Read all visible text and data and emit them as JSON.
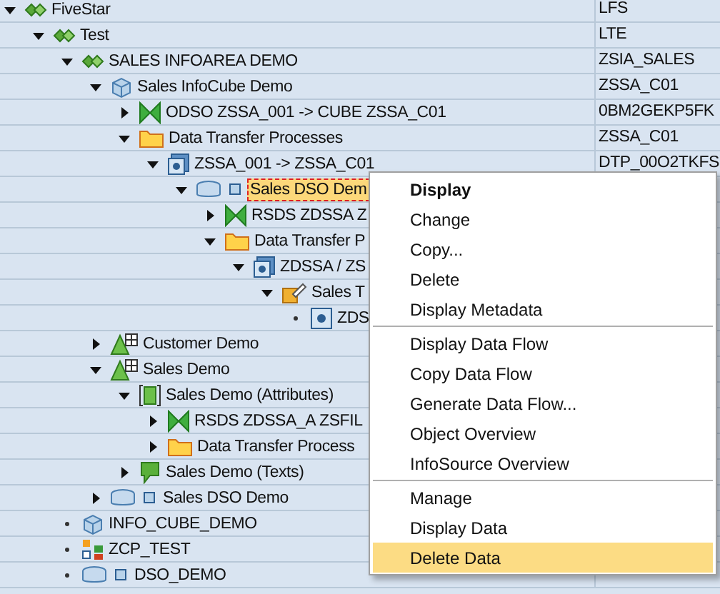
{
  "tree": [
    {
      "label": "FiveStar",
      "kind": "infoarea",
      "expanded": true,
      "selected": false,
      "technical_name": "LFS",
      "children": [
        {
          "label": "Test",
          "kind": "infoarea",
          "expanded": true,
          "selected": false,
          "technical_name": "LTE",
          "children": [
            {
              "label": "SALES INFOAREA DEMO",
              "kind": "infoarea",
              "expanded": true,
              "selected": false,
              "technical_name": "ZSIA_SALES",
              "children": [
                {
                  "label": "Sales InfoCube Demo",
                  "kind": "cube",
                  "expanded": true,
                  "selected": false,
                  "technical_name": "ZSSA_C01",
                  "children": [
                    {
                      "label": "ODSO ZSSA_001 -> CUBE ZSSA_C01",
                      "kind": "transformation",
                      "expanded": false,
                      "selected": false,
                      "technical_name": "0BM2GEKP5FK"
                    },
                    {
                      "label": "Data Transfer Processes",
                      "kind": "folder",
                      "expanded": true,
                      "selected": false,
                      "technical_name": "ZSSA_C01",
                      "children": [
                        {
                          "label": "ZSSA_001 -> ZSSA_C01",
                          "kind": "dtp",
                          "expanded": true,
                          "selected": false,
                          "technical_name": "DTP_00O2TKFS",
                          "children": [
                            {
                              "label": "Sales DSO Dem",
                              "kind": "dso",
                              "expanded": true,
                              "selected": true,
                              "children": [
                                {
                                  "label": "RSDS ZDSSA Z",
                                  "kind": "transformation",
                                  "expanded": false,
                                  "selected": false
                                },
                                {
                                  "label": "Data Transfer P",
                                  "kind": "folder",
                                  "expanded": true,
                                  "selected": false,
                                  "children": [
                                    {
                                      "label": "ZDSSA / ZS",
                                      "kind": "dtp",
                                      "expanded": true,
                                      "selected": false,
                                      "children": [
                                        {
                                          "label": "Sales T",
                                          "kind": "infosource",
                                          "expanded": true,
                                          "selected": false,
                                          "children": [
                                            {
                                              "label": "ZDS",
                                              "kind": "datasource",
                                              "selected": false
                                            }
                                          ]
                                        }
                                      ]
                                    }
                                  ]
                                }
                              ]
                            }
                          ]
                        }
                      ]
                    }
                  ]
                },
                {
                  "label": "Customer Demo",
                  "kind": "characteristic",
                  "expanded": false,
                  "selected": false
                },
                {
                  "label": "Sales Demo",
                  "kind": "characteristic",
                  "expanded": true,
                  "selected": false,
                  "children": [
                    {
                      "label": "Sales Demo (Attributes)",
                      "kind": "attributes",
                      "expanded": true,
                      "selected": false,
                      "children": [
                        {
                          "label": "RSDS ZDSSA_A ZSFIL",
                          "kind": "transformation",
                          "expanded": false,
                          "selected": false
                        },
                        {
                          "label": "Data Transfer Process",
                          "kind": "folder",
                          "expanded": false,
                          "selected": false
                        }
                      ]
                    },
                    {
                      "label": "Sales Demo (Texts)",
                      "kind": "texts",
                      "expanded": false,
                      "selected": false
                    }
                  ]
                },
                {
                  "label": "Sales DSO Demo",
                  "kind": "dso",
                  "expanded": false,
                  "selected": false
                }
              ]
            },
            {
              "label": "INFO_CUBE_DEMO",
              "kind": "cube",
              "selected": false
            },
            {
              "label": "ZCP_TEST",
              "kind": "squares",
              "selected": false
            },
            {
              "label": "DSO_DEMO",
              "kind": "dso",
              "selected": false
            }
          ]
        }
      ]
    }
  ],
  "context_menu": [
    {
      "label": "Display",
      "kind": "item",
      "bold": true,
      "selected": false
    },
    {
      "label": "Change",
      "kind": "item",
      "bold": false,
      "selected": false
    },
    {
      "label": "Copy...",
      "kind": "item",
      "bold": false,
      "selected": false
    },
    {
      "label": "Delete",
      "kind": "item",
      "bold": false,
      "selected": false
    },
    {
      "label": "Display Metadata",
      "kind": "item",
      "bold": false,
      "selected": false
    },
    {
      "kind": "separator"
    },
    {
      "label": "Display Data Flow",
      "kind": "item",
      "bold": false,
      "selected": false
    },
    {
      "label": "Copy Data Flow",
      "kind": "item",
      "bold": false,
      "selected": false
    },
    {
      "label": "Generate Data Flow...",
      "kind": "item",
      "bold": false,
      "selected": false
    },
    {
      "label": "Object Overview",
      "kind": "item",
      "bold": false,
      "selected": false
    },
    {
      "label": "InfoSource Overview",
      "kind": "item",
      "bold": false,
      "selected": false
    },
    {
      "kind": "separator"
    },
    {
      "label": "Manage",
      "kind": "item",
      "bold": false,
      "selected": false
    },
    {
      "label": "Display Data",
      "kind": "item",
      "bold": false,
      "selected": false
    },
    {
      "label": "Delete Data",
      "kind": "item",
      "bold": false,
      "selected": true
    }
  ]
}
